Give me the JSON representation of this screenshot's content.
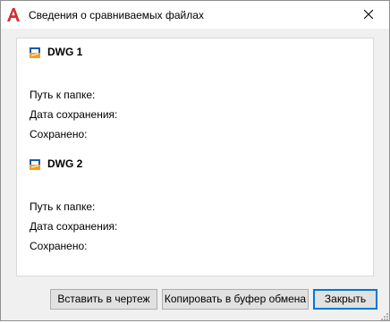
{
  "window": {
    "title": "Сведения о сравниваемых файлах"
  },
  "files": [
    {
      "name": "DWG 1",
      "folder_label": "Путь к папке:",
      "save_date_label": "Дата сохранения:",
      "saved_by_label": "Сохранено:"
    },
    {
      "name": "DWG 2",
      "folder_label": "Путь к папке:",
      "save_date_label": "Дата сохранения:",
      "saved_by_label": "Сохранено:"
    }
  ],
  "buttons": {
    "insert": "Вставить в чертеж",
    "copy": "Копировать в буфер обмена",
    "close": "Закрыть"
  },
  "colors": {
    "app_icon": "#d32f2f",
    "focus_border": "#0078d7",
    "dwg_icon_blue": "#1e5aa8",
    "dwg_icon_orange": "#f0a020"
  },
  "icons": {
    "app": "autocad-logo-icon",
    "close": "close-icon",
    "file": "dwg-file-icon"
  }
}
